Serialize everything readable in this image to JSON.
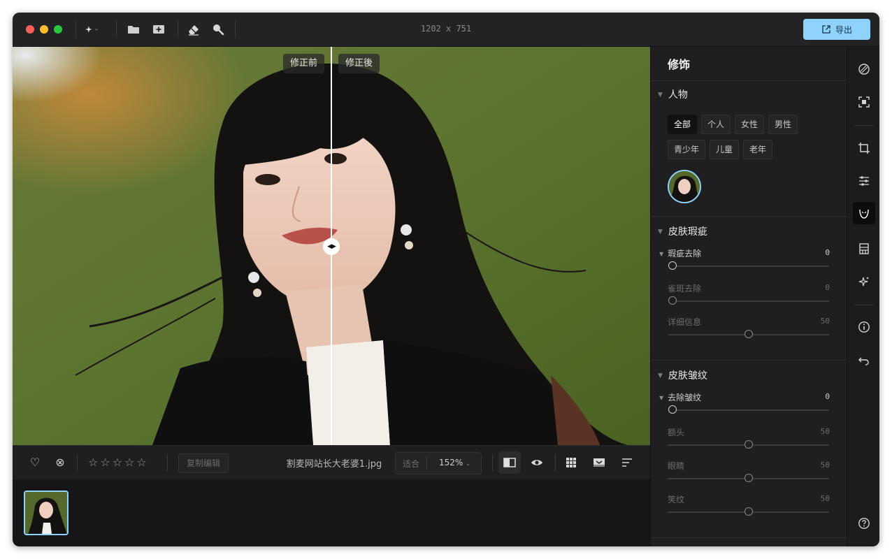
{
  "titlebar": {
    "dimensions": "1202 x 751",
    "export_label": "导出"
  },
  "canvas": {
    "before_label": "修正前",
    "after_label": "修正後"
  },
  "bottombar": {
    "stars": "☆☆☆☆☆",
    "rating": 0,
    "copy_edit_label": "复制编辑",
    "filename": "割麦网站长大老婆1.jpg",
    "zoom_fit_label": "适合",
    "zoom_value": "152%"
  },
  "panel": {
    "title": "修饰",
    "people": {
      "heading": "人物",
      "chips": [
        "全部",
        "个人",
        "女性",
        "男性",
        "青少年",
        "儿童",
        "老年"
      ],
      "active_chip": "全部"
    },
    "blemish": {
      "heading": "皮肤瑕疵",
      "sliders": [
        {
          "label": "瑕疵去除",
          "value": "0"
        },
        {
          "label": "雀斑去除",
          "value": "0"
        },
        {
          "label": "详细信息",
          "value": "50"
        }
      ]
    },
    "wrinkles": {
      "heading": "皮肤皱纹",
      "sliders": [
        {
          "label": "去除皱纹",
          "value": "0"
        },
        {
          "label": "额头",
          "value": "50"
        },
        {
          "label": "眼睛",
          "value": "50"
        },
        {
          "label": "笑纹",
          "value": "50"
        }
      ]
    }
  },
  "rail": {
    "icons": [
      "layers-icon",
      "select-subject-icon",
      "crop-icon",
      "adjust-sliders-icon",
      "face-retouch-icon",
      "background-icon",
      "magic-icon",
      "info-icon",
      "undo-icon",
      "help-icon"
    ],
    "active": "face-retouch-icon"
  },
  "colors": {
    "accent": "#8fd2fb",
    "window_bg": "#1c1c1e",
    "panel_bg": "#1f1f21"
  }
}
